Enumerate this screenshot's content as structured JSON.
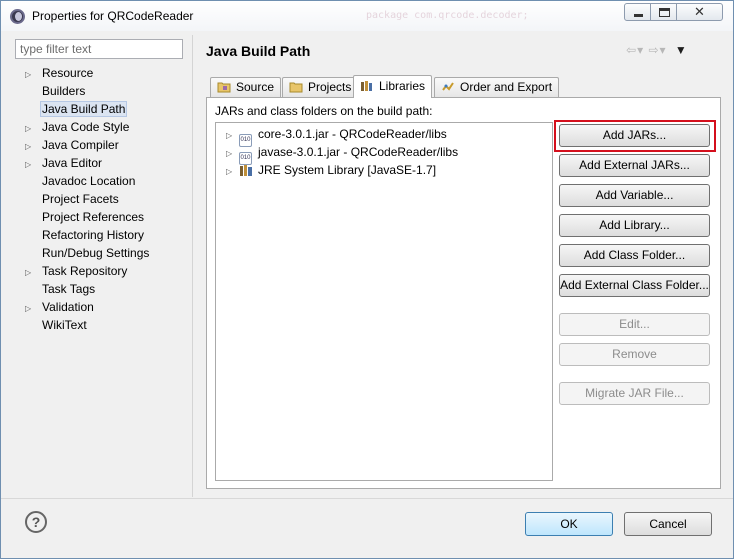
{
  "window": {
    "title": "Properties for QRCodeReader",
    "background_code": "package com.qrcode.decoder;"
  },
  "filter": {
    "placeholder": "type filter text"
  },
  "tree": [
    {
      "label": "Resource",
      "expandable": true
    },
    {
      "label": "Builders",
      "expandable": false
    },
    {
      "label": "Java Build Path",
      "expandable": false,
      "selected": true
    },
    {
      "label": "Java Code Style",
      "expandable": true
    },
    {
      "label": "Java Compiler",
      "expandable": true
    },
    {
      "label": "Java Editor",
      "expandable": true
    },
    {
      "label": "Javadoc Location",
      "expandable": false
    },
    {
      "label": "Project Facets",
      "expandable": false
    },
    {
      "label": "Project References",
      "expandable": false
    },
    {
      "label": "Refactoring History",
      "expandable": false
    },
    {
      "label": "Run/Debug Settings",
      "expandable": false
    },
    {
      "label": "Task Repository",
      "expandable": true
    },
    {
      "label": "Task Tags",
      "expandable": false
    },
    {
      "label": "Validation",
      "expandable": true
    },
    {
      "label": "WikiText",
      "expandable": false
    }
  ],
  "pane": {
    "title": "Java Build Path"
  },
  "tabs": [
    {
      "label": "Source",
      "icon": "source-folder-icon"
    },
    {
      "label": "Projects",
      "icon": "projects-icon"
    },
    {
      "label": "Libraries",
      "icon": "libraries-icon",
      "active": true
    },
    {
      "label": "Order and Export",
      "icon": "order-export-icon"
    }
  ],
  "libraries": {
    "section_label": "JARs and class folders on the build path:",
    "entries": [
      {
        "label": "core-3.0.1.jar - QRCodeReader/libs",
        "icon": "jar-icon"
      },
      {
        "label": "javase-3.0.1.jar - QRCodeReader/libs",
        "icon": "jar-icon"
      },
      {
        "label": "JRE System Library [JavaSE-1.7]",
        "icon": "library-icon"
      }
    ]
  },
  "buttons": {
    "add_jars": "Add JARs...",
    "add_external_jars": "Add External JARs...",
    "add_variable": "Add Variable...",
    "add_library": "Add Library...",
    "add_class_folder": "Add Class Folder...",
    "add_external_class_folder": "Add External Class Folder...",
    "edit": "Edit...",
    "remove": "Remove",
    "migrate_jar": "Migrate JAR File...",
    "ok": "OK",
    "cancel": "Cancel",
    "help": "?"
  },
  "colors": {
    "highlight": "#d40f1c",
    "selection": "#dbe4f1"
  }
}
